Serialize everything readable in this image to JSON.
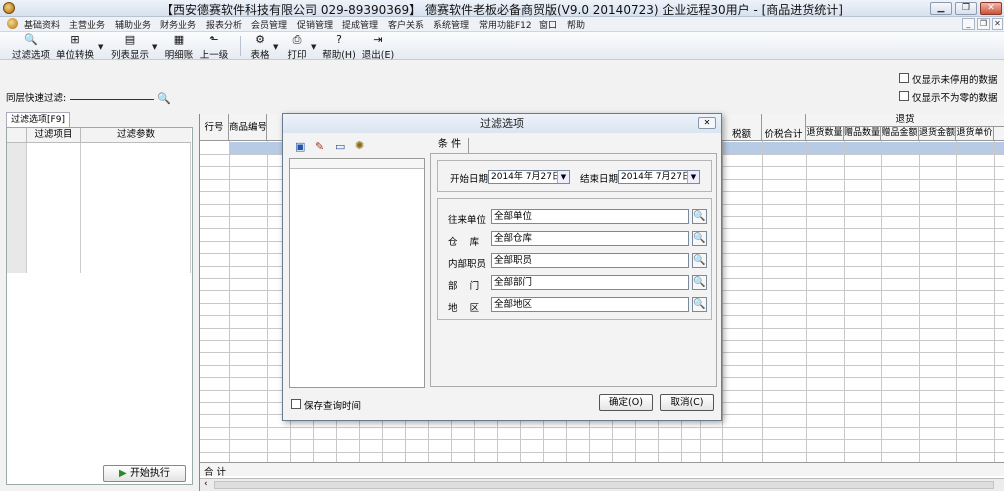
{
  "window": {
    "title": "【西安德赛软件科技有限公司 029-89390369】 德赛软件老板必备商贸版(V9.0 20140723) 企业远程30用户 - [商品进货统计]"
  },
  "menu": [
    "基础资料",
    "主营业务",
    "辅助业务",
    "财务业务",
    "报表分析",
    "会员管理",
    "促销管理",
    "提成管理",
    "客户关系",
    "系统管理",
    "常用功能F12",
    "窗口",
    "帮助"
  ],
  "toolbar": {
    "filter_options": "过滤选项",
    "unit_convert": "单位转换",
    "list_display": "列表显示",
    "detail_ledger": "明细账",
    "up_level": "上一级",
    "table": "表格",
    "print": "打印",
    "help": "帮助(H)",
    "exit": "退出(E)"
  },
  "filter": {
    "quick_filter_label": "同层快速过滤:"
  },
  "options": {
    "only_active": "仅显示未停用的数据",
    "only_nonzero": "仅显示不为零的数据"
  },
  "left_panel": {
    "tab": "过滤选项[F9]",
    "col_item": "过滤项目",
    "col_param": "过滤参数",
    "run_button": "开始执行"
  },
  "grid": {
    "row_no": "行号",
    "product_code": "商品编号",
    "tax_amount": "税额",
    "price_tax_total": "价税合计",
    "returns_group": "退货",
    "return_qty": "退货数量",
    "gift_qty": "赠品数量",
    "gift_amount": "赠品金额",
    "return_amount": "退货金额",
    "return_price": "退货单价",
    "total_label": "合 计"
  },
  "dialog": {
    "title": "过滤选项",
    "tab_conditions": "条 件",
    "start_date_label": "开始日期",
    "start_date": "2014年 7月27日",
    "end_date_label": "结束日期",
    "end_date": "2014年 7月27日",
    "partner_label": "往来单位",
    "partner": "全部单位",
    "warehouse_label": "仓    库",
    "warehouse": "全部仓库",
    "staff_label": "内部职员",
    "staff": "全部职员",
    "dept_label": "部    门",
    "dept": "全部部门",
    "region_label": "地    区",
    "region": "全部地区",
    "save_query_time": "保存查询时间",
    "ok": "确定(O)",
    "cancel": "取消(C)"
  }
}
